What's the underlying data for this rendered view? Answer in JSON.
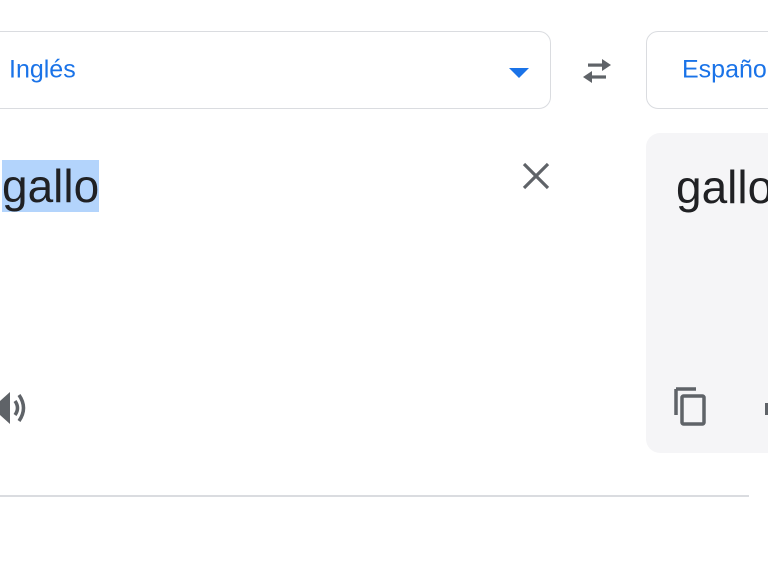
{
  "source": {
    "language_label": "Inglés",
    "text": "gallo"
  },
  "target": {
    "language_label": "Españo",
    "text": "gallo"
  },
  "icons": {
    "dropdown": "chevron-down-icon",
    "swap": "swap-arrows-icon",
    "clear": "close-icon",
    "speaker": "speaker-icon",
    "copy": "copy-icon"
  },
  "colors": {
    "accent": "#1a73e8",
    "icon": "#5f6368",
    "border": "#dadce0",
    "selection": "#b3d4fc",
    "target_panel_bg": "#f5f5f7",
    "text": "#202124"
  }
}
